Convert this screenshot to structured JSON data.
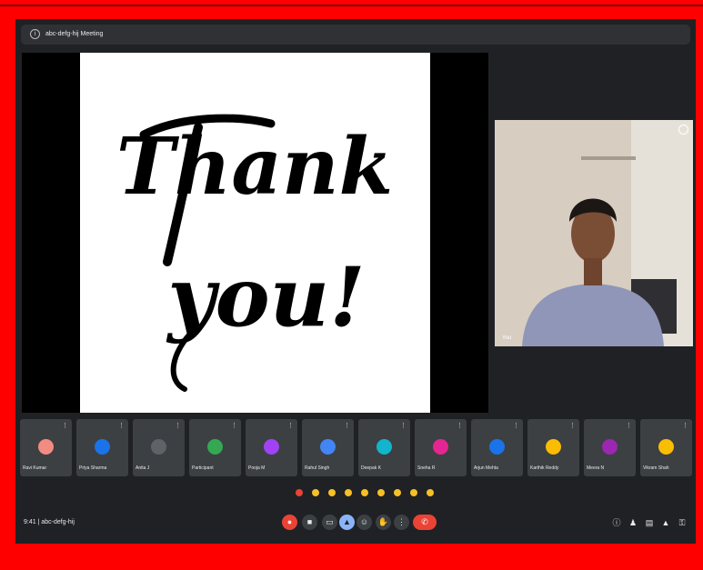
{
  "window": {
    "title": "abc-defg-hij Meeting"
  },
  "slide": {
    "line1": "Thank",
    "line2": "you!"
  },
  "camera": {
    "name": "You"
  },
  "participants": [
    {
      "name": "Ravi Kumar",
      "color": "#f28b82"
    },
    {
      "name": "Priya Sharma",
      "color": "#1a73e8"
    },
    {
      "name": "Anita J",
      "color": "#5f6368"
    },
    {
      "name": "Participant",
      "color": "#34a853"
    },
    {
      "name": "Pooja M",
      "color": "#a142f4"
    },
    {
      "name": "Rahul Singh",
      "color": "#4285f4"
    },
    {
      "name": "Deepak K",
      "color": "#12b5cb"
    },
    {
      "name": "Sneha R",
      "color": "#e52592"
    },
    {
      "name": "Arjun Mehta",
      "color": "#1a73e8"
    },
    {
      "name": "Karthik Reddy",
      "color": "#fbbc04"
    },
    {
      "name": "Meera N",
      "color": "#9c27b0"
    },
    {
      "name": "Vikram Shah",
      "color": "#fbbc04"
    }
  ],
  "bottombar": {
    "time": "9:41 | abc-defg-hij"
  },
  "colors": {
    "frame": "#ff0000",
    "background": "#202124",
    "tile": "#3c4043",
    "end_call": "#ea4335",
    "reaction": "#f6c026"
  }
}
